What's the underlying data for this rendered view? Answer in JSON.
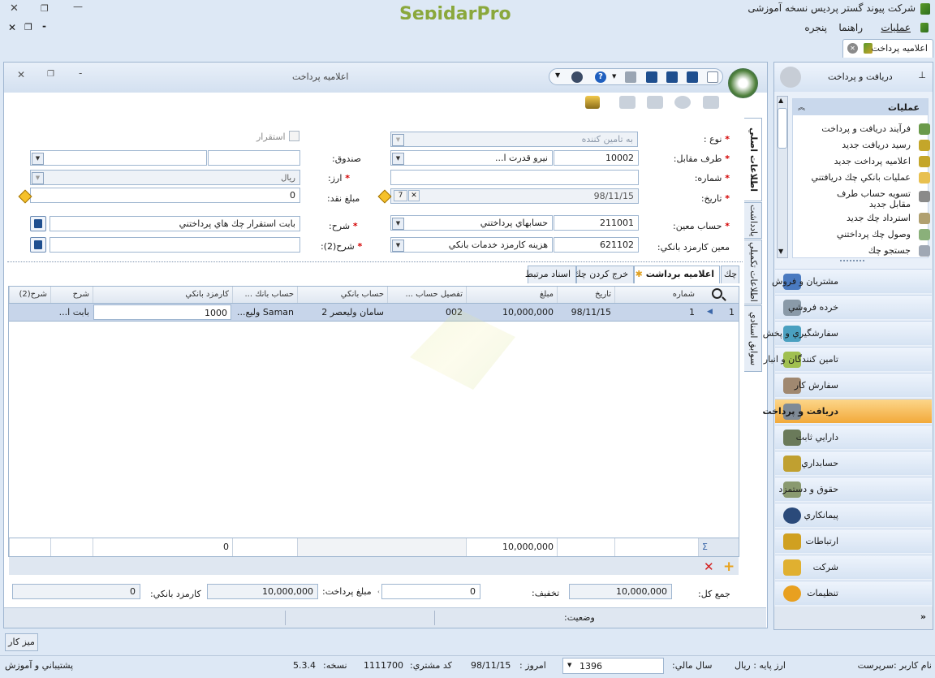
{
  "app": {
    "company_title": "شرکت پیوند گستر پردیس نسخه آموزشی",
    "logo": "SepidarPro"
  },
  "menu": {
    "operations": "عملیات",
    "help": "راهنما",
    "window": "پنجره"
  },
  "doc_tab": {
    "label": "اعلامیه پرداخت"
  },
  "window": {
    "title": "اعلامیه پرداخت"
  },
  "form": {
    "type_label": "نوع :",
    "type_value": "به تامین کننده",
    "counterparty_label": "طرف مقابل:",
    "counterparty_code": "10002",
    "counterparty_name": "نیرو قدرت ا...",
    "number_label": "شماره:",
    "number_value": "",
    "date_label": "تاریخ:",
    "date_value": "98/11/15",
    "main_account_label": "حساب معین:",
    "main_account_code": "211001",
    "main_account_name": "حسابهاي پرداختني",
    "bank_fee_account_label": "معین کارمزد بانکي:",
    "bank_fee_account_code": "621102",
    "bank_fee_account_name": "هزینه کارمزد خدمات بانکي",
    "settle_label": "استقرار",
    "cashbox_label": "صندوق:",
    "currency_label": "ارز:",
    "currency_value": "ریال",
    "cash_amount_label": "مبلغ نقد:",
    "cash_amount_value": "0",
    "desc_label": "شرح:",
    "desc_value": "بابت استقرار چك هاي پرداختني",
    "desc2_label": "شرح(2):",
    "desc2_value": ""
  },
  "side_tabs": {
    "main_info": "اطلاعات اصلي",
    "extra_info": "اطلاعات تکمیلي",
    "notes": "یادداشت",
    "docs": "سوابق اسنادي"
  },
  "tabs": [
    "چك",
    "اعلامیه برداشت",
    "خرج کردن چك",
    "اسناد مرتبط"
  ],
  "grid": {
    "headers": [
      "شماره",
      "تاریخ",
      "مبلغ",
      "تفصیل حساب ...",
      "حساب بانکي",
      "حساب بانك ...",
      "کارمزد بانکي",
      "شرح",
      "شرح(2)"
    ],
    "rows": [
      {
        "row_no": "1",
        "number": "1",
        "date": "98/11/15",
        "amount": "10,000,000",
        "detail": "002",
        "bank_account": "سامان ولیعصر 2",
        "bank_account2": "Saman ولیع...",
        "fee": "1000",
        "desc": "بابت ا...",
        "desc2": ""
      }
    ],
    "sum_symbol": "Σ",
    "sum_amount": "10,000,000",
    "sum_fee": "0"
  },
  "totals": {
    "total_label": "جمع کل:",
    "total_value": "10,000,000",
    "discount_label": "تخفیف:",
    "discount_value": "0",
    "paid_label": "مبلغ پرداخت:",
    "paid_value": "10,000,000",
    "fee_label": "کارمزد بانکي:",
    "fee_value": "0"
  },
  "status_label": "وضعیت:",
  "sidebar": {
    "header": "دریافت و پرداخت",
    "ops_title": "عملیات",
    "ops": [
      "فرآیند دریافت و پرداخت",
      "رسید دریافت جدید",
      "اعلامیه پرداخت جدید",
      "عملیات بانکي چك دریافتني",
      "تسویه حساب طرف مقابل جدید",
      "استرداد چك جدید",
      "وصول چك پرداختني",
      "جستجو چك"
    ],
    "modules": [
      "مشتریان و فروش",
      "خرده فروشي",
      "سفارشگیري و پخش",
      "تامین کنندگان و انبار",
      "سفارش کار",
      "دریافت و پرداخت",
      "دارایي ثابت",
      "حسابداري",
      "حقوق و دستمزد",
      "پیمانکاري",
      "ارتباطات",
      "شرکت",
      "تنظیمات"
    ],
    "active_module": "دریافت و پرداخت"
  },
  "desktop_button": "میز کار",
  "statusbar": {
    "user": "نام کاربر :سرپرست",
    "base_currency": "ارز پایه : ریال",
    "fiscal_year_label": "سال مالي:",
    "fiscal_year": "1396",
    "today_label": "امروز :",
    "today": "98/11/15",
    "customer_code_label": "کد مشتري:",
    "customer_code": "1111700",
    "version_label": "نسخه:",
    "version": "5.3.4",
    "support": "پشتیباني و آموزش"
  }
}
